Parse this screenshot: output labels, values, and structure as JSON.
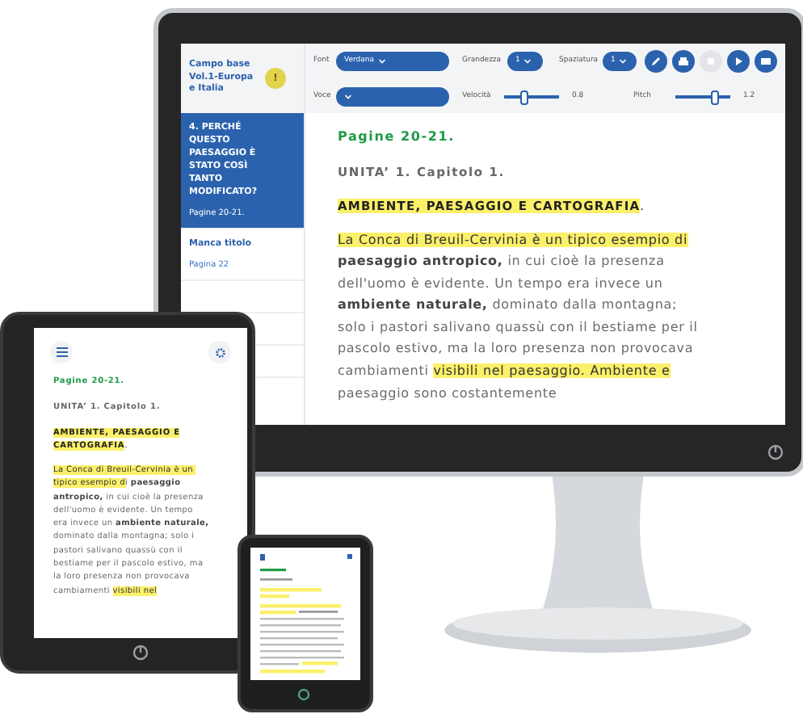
{
  "monitor": {
    "sidebar": {
      "book_title": "Campo base Vol.1-Europa e Italia",
      "alert_badge": "!",
      "items": [
        {
          "title": "4. PERCHÉ QUESTO PAESAGGIO È STATO COSÌ TANTO MODIFICATO?",
          "subtitle": "Pagine 20-21.",
          "selected": true
        },
        {
          "title": "Manca titolo",
          "subtitle": "Pagina 22",
          "selected": false
        }
      ]
    },
    "toolbar": {
      "font": {
        "label": "Font",
        "value": "Verdana"
      },
      "size": {
        "label": "Grandezza",
        "value": "1"
      },
      "spacing": {
        "label": "Spaziatura",
        "value": "1"
      },
      "voice": {
        "label": "Voce"
      },
      "speed": {
        "label": "Velocità",
        "level": 0.35,
        "reading": "0.8"
      },
      "pitch": {
        "label": "Pitch",
        "level": 0.75,
        "reading": "1.2"
      },
      "buttons": [
        {
          "disabled": false
        },
        {
          "disabled": false
        },
        {
          "disabled": true
        },
        {
          "disabled": false
        },
        {
          "disabled": false
        }
      ]
    },
    "content": {
      "page_heading": "Pagine 20-21.",
      "unit": "UNITA’ 1. Capitolo 1.",
      "section_title": [
        {
          "text": "AMBIENTE, PAESAGGIO E CARTOGRAFIA",
          "highlighted": true
        },
        {
          "text": ".",
          "highlighted": false
        }
      ],
      "paragraph": [
        {
          "text": "La Conca di Breuil-Cervinia è un tipico esempio di",
          "highlighted": true,
          "bold": false
        },
        {
          "text": " paesaggio antropico,",
          "highlighted": false,
          "bold": true
        },
        {
          "text": " in cui cioè la presenza dell'uomo è evidente. Un tempo era invece un ",
          "highlighted": false,
          "bold": false
        },
        {
          "text": "ambiente naturale,",
          "highlighted": false,
          "bold": true
        },
        {
          "text": " dominato dalla montagna; solo i pastori salivano quassù con il bestiame per il pascolo estivo, ma la loro presenza non provocava cambiamenti ",
          "highlighted": false,
          "bold": false
        },
        {
          "text": "visibili nel paesaggio. ",
          "highlighted": true,
          "bold": false
        },
        {
          "text": "Ambiente e",
          "highlighted": true,
          "bold": false
        },
        {
          "text": " paesaggio sono costantemente",
          "highlighted": false,
          "bold": false
        }
      ]
    }
  },
  "tablet": {
    "content": {
      "page_heading": "Pagine 20-21.",
      "unit": "UNITA’ 1. Capitolo 1.",
      "section_title": [
        {
          "text": "AMBIENTE, PAESAGGIO E CARTOGRAFIA",
          "highlighted": true
        },
        {
          "text": ".",
          "highlighted": false
        }
      ],
      "paragraph": [
        {
          "text": "La Conca di Breuil-Cervinia è un tipico esempio d",
          "highlighted": true,
          "bold": false
        },
        {
          "text": "i ",
          "highlighted": false,
          "bold": false
        },
        {
          "text": "paesaggio antropico,",
          "highlighted": false,
          "bold": true
        },
        {
          "text": " in cui cioè la presenza dell'uomo è evidente. Un tempo era invece un ",
          "highlighted": false,
          "bold": false
        },
        {
          "text": "ambiente naturale,",
          "highlighted": false,
          "bold": true
        },
        {
          "text": " dominato dalla montagna; solo i pastori salivano quassù con il bestiame per il pascolo estivo, ma la loro presenza non provocava cambiamenti ",
          "highlighted": false,
          "bold": false
        },
        {
          "text": "visibili nel",
          "highlighted": true,
          "bold": false
        }
      ]
    }
  }
}
